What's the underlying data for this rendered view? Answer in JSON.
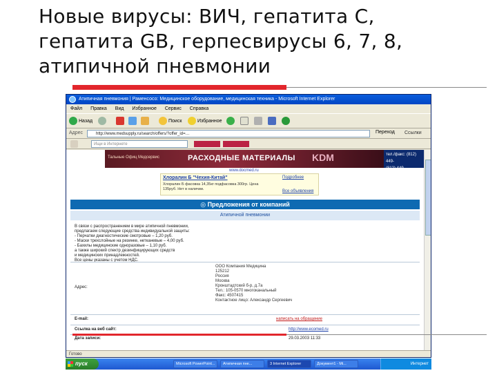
{
  "slide": {
    "title_line1": "Новые вирусы: ВИЧ, гепатита С,",
    "title_line2": "гепатита GB, герпесвирусы 6, 7, 8,",
    "title_line3": "атипичной пневмонии"
  },
  "browser": {
    "window_title": "Атипичная пневмония | Раменсосо: Медицинское оборудование, медицинская техника - Microsoft Internet Explorer",
    "menu": [
      "Файл",
      "Правка",
      "Вид",
      "Избранное",
      "Сервис",
      "Справка"
    ],
    "toolbar": {
      "back_label": "Назад",
      "search_label": "Поиск",
      "favorites_label": "Избранное"
    },
    "address": {
      "label": "Адрес",
      "url": "http://www.medsupply.ru/search/offers/?offer_id=…",
      "go_label": "Переход",
      "links_label": "Ссылки"
    },
    "search_placeholder": "Ищи в Интернете"
  },
  "page": {
    "banner_logo": "Тальные Офиц Медсервис",
    "banner_text": "РАСХОДНЫЕ МАТЕРИАЛЫ",
    "banner_brand": "KDM",
    "phone_line1": "тел./факс: (812) 449-",
    "phone_line2": "(812) 449-",
    "site_url": "www.docmed.ru",
    "promo": {
      "link": "Хлоралин Б \"Чехия-Китай\"",
      "text": "Хлоралин Б фасовка 14,35кг подфасовка 300гр. Цена 135руб. Нет в наличии.",
      "side_link": "Подробнее",
      "side_link2": "Все объявления"
    },
    "section_head": "Предложения от компаний",
    "offer_title": "Атипичной пневмонии",
    "desc_lines": [
      "В связи с распространением в мире атипичной пневмонии,",
      "предлагаем следующие средства индивидуальной защиты:",
      "- Перчатки диагностические смотровые – 1,20 руб.",
      "- Маски трехслойные на резинке, нетканевые – 4,00 руб.",
      "- Бахилы медицинские одноразовые – 1,10 руб.",
      "а также широкий спектр дезинфицирующих средств",
      "и медицинских принадлежностей.",
      "Все цены указаны с учетом НДС."
    ],
    "address_label": "Адрес:",
    "address_lines": [
      "ООО Компания Медицина",
      "125212",
      "Россия",
      "Москва",
      "Кронштадтский б-р, д.7а",
      "Тел.: 105-0570 многоканальный",
      "Факс: 4507415",
      "Контактное лицо: Александр Сергеевич"
    ],
    "email_label": "E-mail:",
    "email_value": "написать на обращение",
    "site_label": "Ссылка на веб сайт:",
    "site_value": "http://www.ecomed.ru",
    "date_label": "Дата записи:",
    "date_value": "29.03.2003 11:33"
  },
  "statusbar": "Готово",
  "taskbar": {
    "start_label": "пуск",
    "tasks": [
      "Microsoft PowerPoint...",
      "Атипичная пне...",
      "3 Internet Explorer",
      "Документ1 - Mi..."
    ],
    "tray_label": "Интернет"
  }
}
